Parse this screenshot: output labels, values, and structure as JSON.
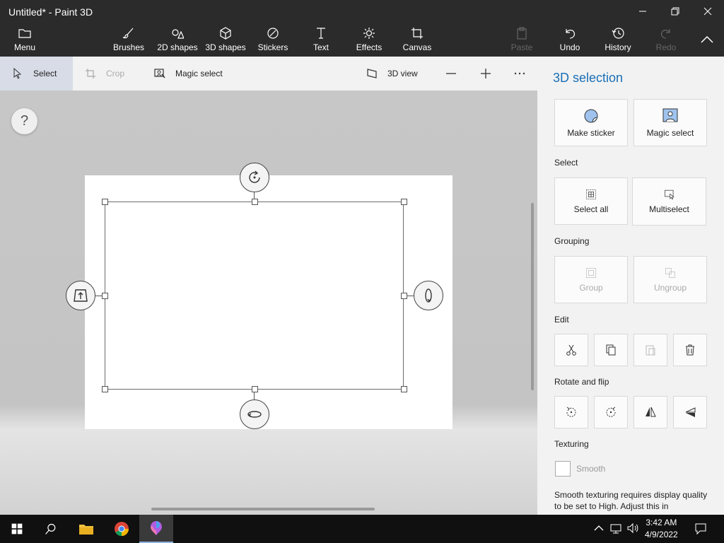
{
  "window": {
    "title": "Untitled* - Paint 3D"
  },
  "toolbar": {
    "menu": "Menu",
    "brushes": "Brushes",
    "shapes2d": "2D shapes",
    "shapes3d": "3D shapes",
    "stickers": "Stickers",
    "text": "Text",
    "effects": "Effects",
    "canvas": "Canvas",
    "paste": "Paste",
    "undo": "Undo",
    "history": "History",
    "redo": "Redo"
  },
  "subbar": {
    "select": "Select",
    "crop": "Crop",
    "magic_select": "Magic select",
    "view3d": "3D view"
  },
  "workspace": {
    "help": "?"
  },
  "panel": {
    "title": "3D selection",
    "make_sticker": "Make sticker",
    "magic_select": "Magic select",
    "select_section": "Select",
    "select_all": "Select all",
    "multiselect": "Multiselect",
    "grouping_section": "Grouping",
    "group": "Group",
    "ungroup": "Ungroup",
    "edit_section": "Edit",
    "rotate_section": "Rotate and flip",
    "texturing_section": "Texturing",
    "smooth": "Smooth",
    "smooth_note": "Smooth texturing requires display quality to be set to High. Adjust this in"
  },
  "taskbar": {
    "time": "3:42 AM",
    "date": "4/9/2022"
  },
  "colors": {
    "accent": "#1a6fb5",
    "titlebar": "#2b2b2b",
    "taskbar": "#101010"
  }
}
